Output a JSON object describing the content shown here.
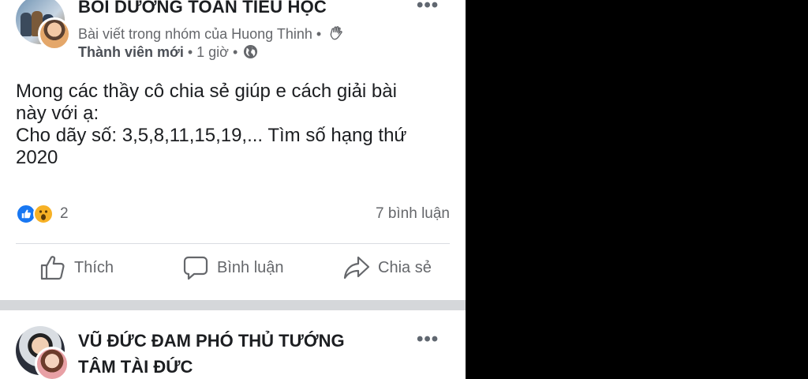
{
  "post1": {
    "group_name": "BỒI DƯỠNG TOÁN TIỂU HỌC",
    "subtitle": "Bài viết trong nhóm của Huong Thinh •",
    "member_badge": "Thành viên mới",
    "meta": " • 1 giờ •",
    "body_lines": [
      "Mong các thầy cô chia sẻ giúp e cách giải bài",
      "này với ạ:",
      "Cho dãy số: 3,5,8,11,15,19,... Tìm số hạng thứ",
      " 2020"
    ],
    "reaction_count": "2",
    "comment_count": "7 bình luận",
    "actions": {
      "like": "Thích",
      "comment": "Bình luận",
      "share": "Chia sẻ"
    },
    "more_label": "•••"
  },
  "post2": {
    "title_lines": [
      "VŨ ĐỨC ĐAM PHÓ THỦ TƯỚNG",
      "TÂM TÀI ĐỨC"
    ],
    "more_label": "•••"
  },
  "colors": {
    "like_blue": "#1877f2",
    "wow_yellow": "#f7b125",
    "secondary_text": "#65676b",
    "separator": "#d5d7da"
  },
  "icons": [
    "wave-icon",
    "globe-icon",
    "like-reaction-icon",
    "wow-reaction-icon",
    "thumbs-up-icon",
    "comment-icon",
    "share-icon",
    "more-icon"
  ]
}
